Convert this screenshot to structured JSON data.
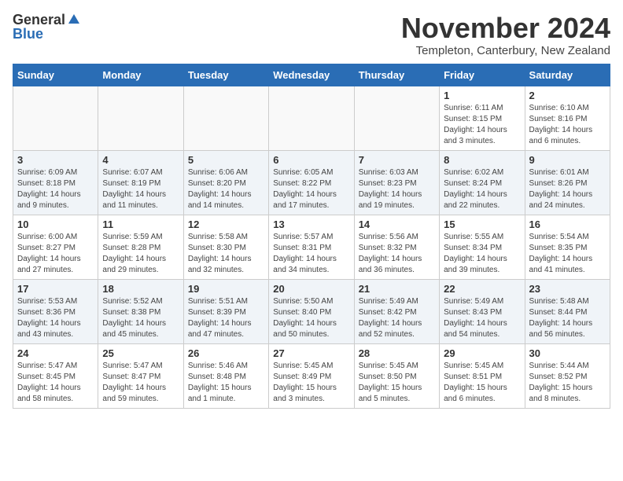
{
  "logo": {
    "general": "General",
    "blue": "Blue"
  },
  "title": "November 2024",
  "location": "Templeton, Canterbury, New Zealand",
  "days_of_week": [
    "Sunday",
    "Monday",
    "Tuesday",
    "Wednesday",
    "Thursday",
    "Friday",
    "Saturday"
  ],
  "weeks": [
    [
      {
        "day": "",
        "empty": true
      },
      {
        "day": "",
        "empty": true
      },
      {
        "day": "",
        "empty": true
      },
      {
        "day": "",
        "empty": true
      },
      {
        "day": "",
        "empty": true
      },
      {
        "day": "1",
        "sunrise": "6:11 AM",
        "sunset": "8:15 PM",
        "daylight": "14 hours and 3 minutes."
      },
      {
        "day": "2",
        "sunrise": "6:10 AM",
        "sunset": "8:16 PM",
        "daylight": "14 hours and 6 minutes."
      }
    ],
    [
      {
        "day": "3",
        "sunrise": "6:09 AM",
        "sunset": "8:18 PM",
        "daylight": "14 hours and 9 minutes."
      },
      {
        "day": "4",
        "sunrise": "6:07 AM",
        "sunset": "8:19 PM",
        "daylight": "14 hours and 11 minutes."
      },
      {
        "day": "5",
        "sunrise": "6:06 AM",
        "sunset": "8:20 PM",
        "daylight": "14 hours and 14 minutes."
      },
      {
        "day": "6",
        "sunrise": "6:05 AM",
        "sunset": "8:22 PM",
        "daylight": "14 hours and 17 minutes."
      },
      {
        "day": "7",
        "sunrise": "6:03 AM",
        "sunset": "8:23 PM",
        "daylight": "14 hours and 19 minutes."
      },
      {
        "day": "8",
        "sunrise": "6:02 AM",
        "sunset": "8:24 PM",
        "daylight": "14 hours and 22 minutes."
      },
      {
        "day": "9",
        "sunrise": "6:01 AM",
        "sunset": "8:26 PM",
        "daylight": "14 hours and 24 minutes."
      }
    ],
    [
      {
        "day": "10",
        "sunrise": "6:00 AM",
        "sunset": "8:27 PM",
        "daylight": "14 hours and 27 minutes."
      },
      {
        "day": "11",
        "sunrise": "5:59 AM",
        "sunset": "8:28 PM",
        "daylight": "14 hours and 29 minutes."
      },
      {
        "day": "12",
        "sunrise": "5:58 AM",
        "sunset": "8:30 PM",
        "daylight": "14 hours and 32 minutes."
      },
      {
        "day": "13",
        "sunrise": "5:57 AM",
        "sunset": "8:31 PM",
        "daylight": "14 hours and 34 minutes."
      },
      {
        "day": "14",
        "sunrise": "5:56 AM",
        "sunset": "8:32 PM",
        "daylight": "14 hours and 36 minutes."
      },
      {
        "day": "15",
        "sunrise": "5:55 AM",
        "sunset": "8:34 PM",
        "daylight": "14 hours and 39 minutes."
      },
      {
        "day": "16",
        "sunrise": "5:54 AM",
        "sunset": "8:35 PM",
        "daylight": "14 hours and 41 minutes."
      }
    ],
    [
      {
        "day": "17",
        "sunrise": "5:53 AM",
        "sunset": "8:36 PM",
        "daylight": "14 hours and 43 minutes."
      },
      {
        "day": "18",
        "sunrise": "5:52 AM",
        "sunset": "8:38 PM",
        "daylight": "14 hours and 45 minutes."
      },
      {
        "day": "19",
        "sunrise": "5:51 AM",
        "sunset": "8:39 PM",
        "daylight": "14 hours and 47 minutes."
      },
      {
        "day": "20",
        "sunrise": "5:50 AM",
        "sunset": "8:40 PM",
        "daylight": "14 hours and 50 minutes."
      },
      {
        "day": "21",
        "sunrise": "5:49 AM",
        "sunset": "8:42 PM",
        "daylight": "14 hours and 52 minutes."
      },
      {
        "day": "22",
        "sunrise": "5:49 AM",
        "sunset": "8:43 PM",
        "daylight": "14 hours and 54 minutes."
      },
      {
        "day": "23",
        "sunrise": "5:48 AM",
        "sunset": "8:44 PM",
        "daylight": "14 hours and 56 minutes."
      }
    ],
    [
      {
        "day": "24",
        "sunrise": "5:47 AM",
        "sunset": "8:45 PM",
        "daylight": "14 hours and 58 minutes."
      },
      {
        "day": "25",
        "sunrise": "5:47 AM",
        "sunset": "8:47 PM",
        "daylight": "14 hours and 59 minutes."
      },
      {
        "day": "26",
        "sunrise": "5:46 AM",
        "sunset": "8:48 PM",
        "daylight": "15 hours and 1 minute."
      },
      {
        "day": "27",
        "sunrise": "5:45 AM",
        "sunset": "8:49 PM",
        "daylight": "15 hours and 3 minutes."
      },
      {
        "day": "28",
        "sunrise": "5:45 AM",
        "sunset": "8:50 PM",
        "daylight": "15 hours and 5 minutes."
      },
      {
        "day": "29",
        "sunrise": "5:45 AM",
        "sunset": "8:51 PM",
        "daylight": "15 hours and 6 minutes."
      },
      {
        "day": "30",
        "sunrise": "5:44 AM",
        "sunset": "8:52 PM",
        "daylight": "15 hours and 8 minutes."
      }
    ]
  ]
}
